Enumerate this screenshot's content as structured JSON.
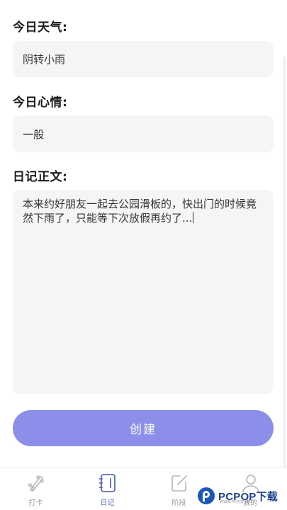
{
  "form": {
    "weather_label": "今日天气:",
    "weather_value": "阴转小雨",
    "mood_label": "今日心情:",
    "mood_value": "一般",
    "body_label": "日记正文:",
    "body_value": "本来约好朋友一起去公园滑板的，快出门的时候竟然下雨了，只能等下次放假再约了...",
    "create_label": "创建"
  },
  "tabbar": {
    "items": [
      {
        "label": "打卡",
        "icon": "skateboard-icon"
      },
      {
        "label": "日记",
        "icon": "notebook-icon",
        "active": true
      },
      {
        "label": "阶段",
        "icon": "edit-icon"
      },
      {
        "label": "我的",
        "icon": "person-icon"
      }
    ]
  },
  "watermark": {
    "brand": "PCPOP下载",
    "sub": "WWW.PCPOP.NET"
  },
  "colors": {
    "button": "#8b8fe9",
    "active_tab": "#5a6fb8",
    "field_bg": "#f5f5f5"
  }
}
